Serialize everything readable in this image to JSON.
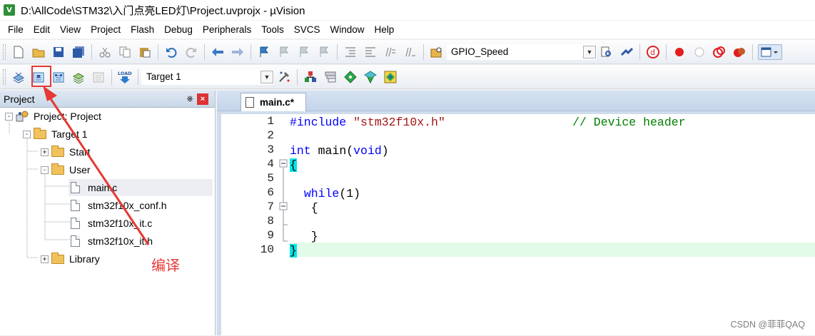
{
  "window": {
    "title": "D:\\AllCode\\STM32\\入门点亮LED灯\\Project.uvprojx - µVision",
    "app_icon_glyph": "V"
  },
  "menu": [
    "File",
    "Edit",
    "View",
    "Project",
    "Flash",
    "Debug",
    "Peripherals",
    "Tools",
    "SVCS",
    "Window",
    "Help"
  ],
  "toolbar1": {
    "find_combo_value": "GPIO_Speed"
  },
  "toolbar2": {
    "target_combo_value": "Target 1",
    "load_label": "LOAD"
  },
  "project_panel": {
    "title": "Project",
    "pin_glyph": "ꟷ",
    "close_glyph": "×",
    "tree": [
      {
        "label": "Project: Project",
        "expander": "-",
        "kind": "project"
      },
      {
        "label": "Target 1",
        "expander": "-",
        "kind": "target"
      },
      {
        "label": "Start",
        "expander": "+",
        "kind": "folder"
      },
      {
        "label": "User",
        "expander": "-",
        "kind": "folder"
      },
      {
        "label": "main.c",
        "kind": "file"
      },
      {
        "label": "stm32f10x_conf.h",
        "kind": "file"
      },
      {
        "label": "stm32f10x_it.c",
        "kind": "file"
      },
      {
        "label": "stm32f10x_it.h",
        "kind": "file"
      },
      {
        "label": "Library",
        "expander": "+",
        "kind": "folder"
      }
    ]
  },
  "annotation": {
    "text": "编译",
    "color": "#e53935"
  },
  "editor": {
    "active_tab": "main.c*",
    "line_numbers": [
      "1",
      "2",
      "3",
      "4",
      "5",
      "6",
      "7",
      "8",
      "9",
      "10"
    ],
    "lines": {
      "l1_directive": "#include",
      "l1_string": "\"stm32f10x.h\"",
      "l1_comment": "// Device header",
      "l3_kw1": "int",
      "l3_name": "main(",
      "l3_kw2": "void",
      "l3_close": ")",
      "l4_brace": "{",
      "l6_kw": "while",
      "l6_rest": "(1)",
      "l7_brace": "{",
      "l9_brace": "}",
      "l10_brace": "}"
    },
    "fold_markers": [
      "-",
      "-"
    ]
  },
  "watermark": "CSDN @菲菲QAQ"
}
